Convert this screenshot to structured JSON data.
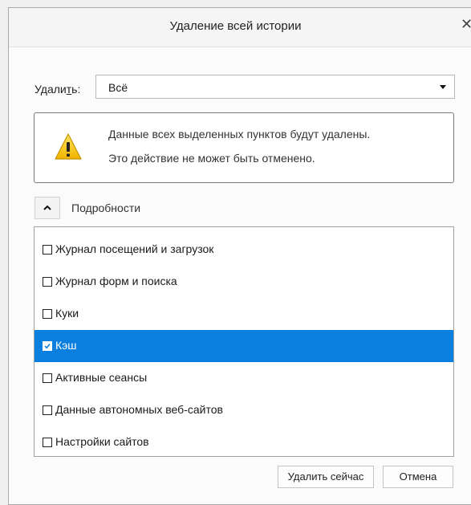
{
  "dialog": {
    "title": "Удаление всей истории",
    "close_glyph": "✕",
    "colors": {
      "selection": "#0a7fe0",
      "warning": "#f5c400"
    }
  },
  "time_range": {
    "label_prefix": "Удали",
    "label_accel": "т",
    "label_suffix": "ь:",
    "selected": "Всё"
  },
  "warning": {
    "icon": "warning-icon",
    "line1": "Данные всех выделенных пунктов будут удалены.",
    "line2": "Это действие не может быть отменено."
  },
  "details": {
    "toggle_icon": "chevron-up-icon",
    "label": "Подробности"
  },
  "items": [
    {
      "label": "Журнал посещений и загрузок",
      "checked": false,
      "selected": false
    },
    {
      "label": "Журнал форм и поиска",
      "checked": false,
      "selected": false
    },
    {
      "label": "Куки",
      "checked": false,
      "selected": false
    },
    {
      "label": "Кэш",
      "checked": true,
      "selected": true
    },
    {
      "label": "Активные сеансы",
      "checked": false,
      "selected": false
    },
    {
      "label": "Данные автономных веб-сайтов",
      "checked": false,
      "selected": false
    },
    {
      "label": "Настройки сайтов",
      "checked": false,
      "selected": false
    }
  ],
  "buttons": {
    "delete_now": "Удалить сейчас",
    "cancel": "Отмена"
  }
}
